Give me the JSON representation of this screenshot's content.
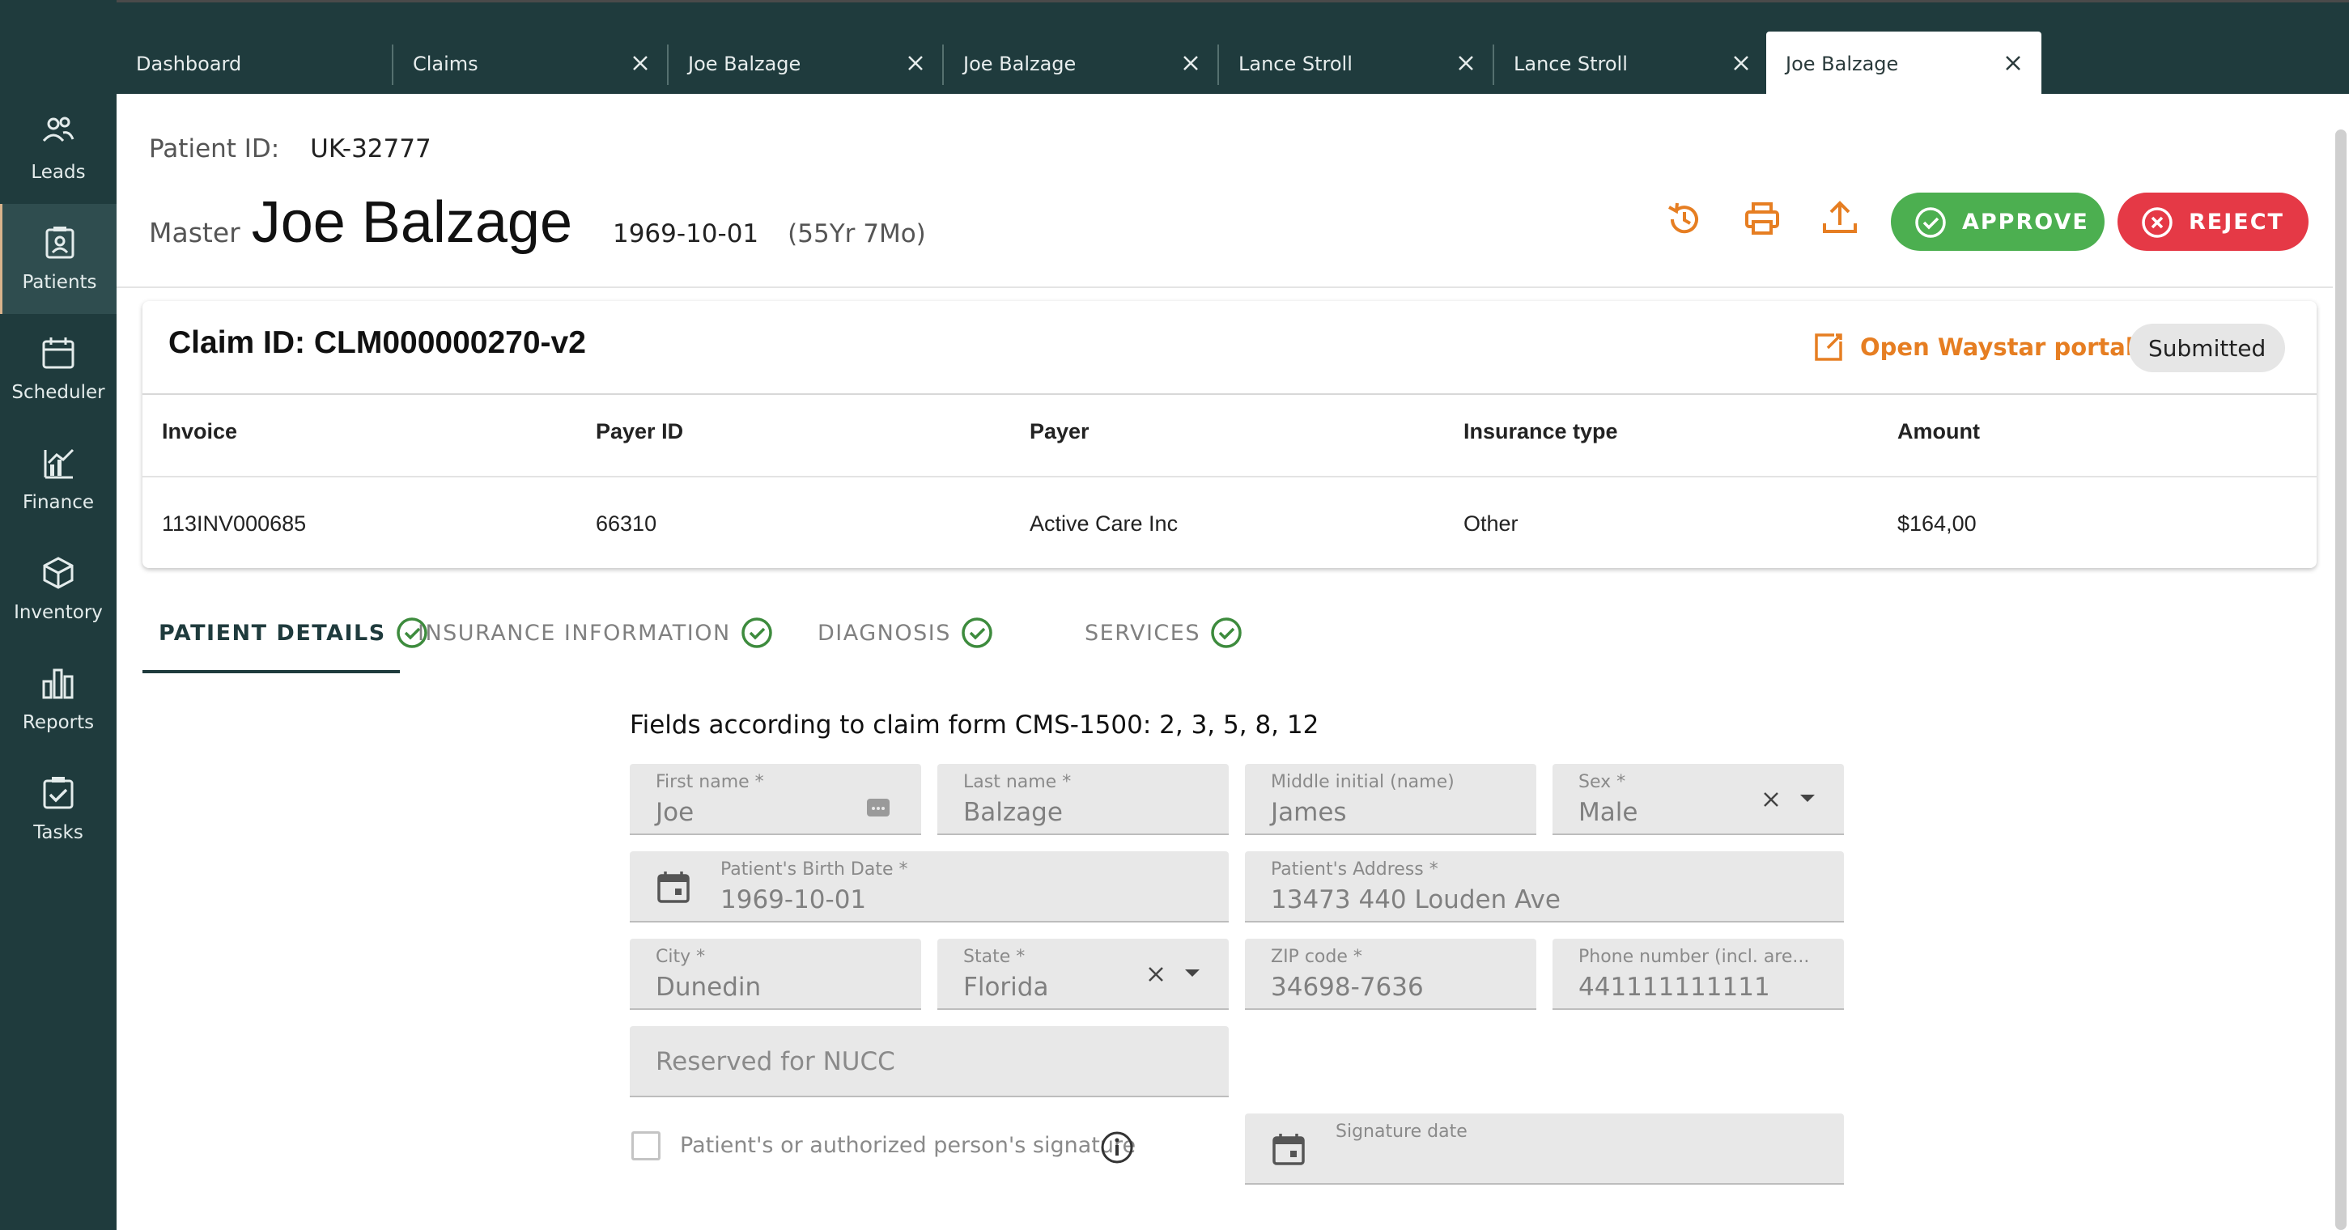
{
  "sidebar": {
    "items": [
      {
        "label": "Leads",
        "icon": "people-icon"
      },
      {
        "label": "Patients",
        "icon": "patient-card-icon",
        "active": true
      },
      {
        "label": "Scheduler",
        "icon": "calendar-icon"
      },
      {
        "label": "Finance",
        "icon": "finance-chart-icon"
      },
      {
        "label": "Inventory",
        "icon": "box-icon"
      },
      {
        "label": "Reports",
        "icon": "bar-chart-icon"
      },
      {
        "label": "Tasks",
        "icon": "checkbox-icon"
      }
    ]
  },
  "tabs": [
    {
      "label": "Dashboard"
    },
    {
      "label": "Claims"
    },
    {
      "label": "Joe Balzage"
    },
    {
      "label": "Joe Balzage"
    },
    {
      "label": "Lance Stroll"
    },
    {
      "label": "Lance Stroll"
    },
    {
      "label": "Joe Balzage",
      "active": true
    }
  ],
  "patient": {
    "id_label": "Patient ID:",
    "id_value": "UK-32777",
    "status_prefix": "Master",
    "name": "Joe Balzage",
    "birth_date": "1969-10-01",
    "age": "(55Yr 7Mo)"
  },
  "actions": {
    "approve_label": "APPROVE",
    "reject_label": "REJECT",
    "approve_color": "#4caf50",
    "reject_color": "#e53946",
    "icon_color": "#e67e22"
  },
  "claim": {
    "title": "Claim ID: CLM000000270-v2",
    "portal_link": "Open Waystar portal",
    "status": "Submitted",
    "columns": [
      "Invoice",
      "Payer ID",
      "Payer",
      "Insurance type",
      "Amount"
    ],
    "row": [
      "113INV000685",
      "66310",
      "Active Care Inc",
      "Other",
      "$164,00"
    ]
  },
  "section_tabs": [
    {
      "label": "PATIENT DETAILS",
      "active": true
    },
    {
      "label": "INSURANCE INFORMATION"
    },
    {
      "label": "DIAGNOSIS"
    },
    {
      "label": "SERVICES"
    }
  ],
  "form": {
    "heading": "Fields according to claim form CMS-1500: 2, 3, 5, 8, 12",
    "first_name": {
      "label": "First name *",
      "value": "Joe"
    },
    "last_name": {
      "label": "Last name *",
      "value": "Balzage"
    },
    "middle_initial": {
      "label": "Middle initial (name)",
      "value": "James"
    },
    "sex": {
      "label": "Sex *",
      "value": "Male"
    },
    "birth_date": {
      "label": "Patient's Birth Date *",
      "value": "1969-10-01"
    },
    "address": {
      "label": "Patient's Address *",
      "value": "13473 440 Louden Ave"
    },
    "city": {
      "label": "City *",
      "value": "Dunedin"
    },
    "state": {
      "label": "State *",
      "value": "Florida"
    },
    "zip": {
      "label": "ZIP code *",
      "value": "34698-7636"
    },
    "phone": {
      "label": "Phone number (incl. are...",
      "value": "441111111111"
    },
    "reserved": {
      "placeholder": "Reserved for NUCC"
    },
    "signature_checkbox_label": "Patient's or authorized person's signature",
    "signature_date": {
      "label": "Signature date"
    }
  }
}
